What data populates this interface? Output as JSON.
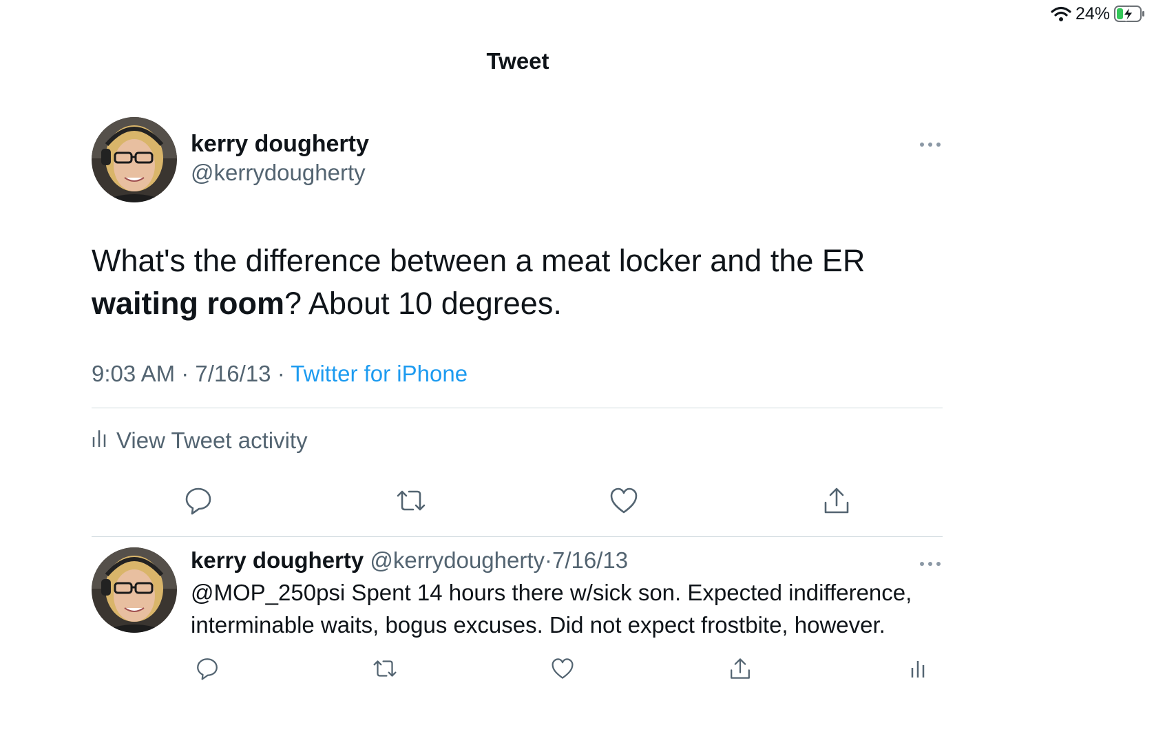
{
  "status_bar": {
    "battery_percent": "24%",
    "battery_level": 0.24,
    "icons": [
      "wifi-icon",
      "battery-charging-icon"
    ]
  },
  "header": {
    "title": "Tweet"
  },
  "tweet": {
    "display_name": "kerry dougherty",
    "handle": "@kerrydougherty",
    "text_part1": "What's the difference between a meat locker and the ER ",
    "text_bold": "waiting room",
    "text_part2": "? About 10 degrees.",
    "time": "9:03 AM",
    "date": "7/16/13",
    "separator": "·",
    "source": "Twitter for iPhone",
    "activity_label": "View Tweet activity",
    "actions": [
      "reply-icon",
      "retweet-icon",
      "like-icon",
      "share-icon"
    ]
  },
  "reply": {
    "display_name": "kerry dougherty",
    "handle": "@kerrydougherty",
    "separator": "·",
    "date": "7/16/13",
    "text": "@MOP_250psi Spent 14 hours there w/sick son. Expected indifference, interminable waits, bogus excuses. Did not expect frostbite, however.",
    "actions": [
      "reply-icon",
      "retweet-icon",
      "like-icon",
      "share-icon",
      "analytics-icon"
    ]
  },
  "colors": {
    "text_primary": "#0f1419",
    "text_secondary": "#536471",
    "link": "#1d9bf0",
    "divider": "#cfd9de",
    "battery_fill": "#34c759"
  }
}
